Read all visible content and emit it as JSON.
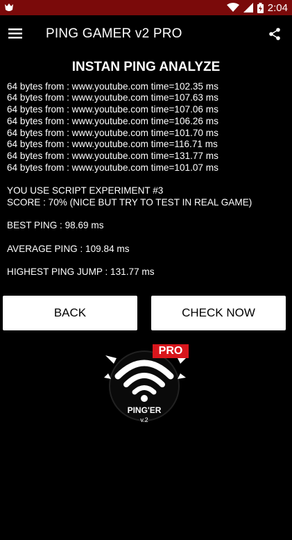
{
  "status_bar": {
    "time": "2:04",
    "colors": {
      "bg": "#7a0a0a"
    },
    "icons": [
      "app-notification-icon",
      "wifi-icon",
      "signal-icon",
      "battery-icon"
    ]
  },
  "app_bar": {
    "title": "PING GAMER v2 PRO",
    "menu_icon": "hamburger-menu-icon",
    "share_icon": "share-icon"
  },
  "heading": "INSTAN PING ANALYZE",
  "log": {
    "lines": [
      "64 bytes from : www.youtube.com time=102.35 ms",
      "64 bytes from : www.youtube.com time=107.63 ms",
      "64 bytes from : www.youtube.com time=107.06 ms",
      "64 bytes from : www.youtube.com time=106.26 ms",
      "64 bytes from : www.youtube.com time=101.70 ms",
      "64 bytes from : www.youtube.com time=116.71 ms",
      "64 bytes from : www.youtube.com time=131.77 ms",
      "64 bytes from : www.youtube.com time=101.07 ms"
    ],
    "script_line": "YOU USE SCRIPT EXPERIMENT #3",
    "score_line": "SCORE : 70% (NICE BUT TRY TO TEST IN REAL GAME)",
    "best_ping": "BEST PING : 98.69 ms",
    "average_ping": "AVERAGE PING : 109.84 ms",
    "highest_jump": "HIGHEST PING JUMP : 131.77 ms"
  },
  "buttons": {
    "back": "BACK",
    "check_now": "CHECK NOW"
  },
  "logo": {
    "badge": "PRO",
    "name": "PING'ER",
    "version": "v.2",
    "badge_color": "#d8161c"
  }
}
